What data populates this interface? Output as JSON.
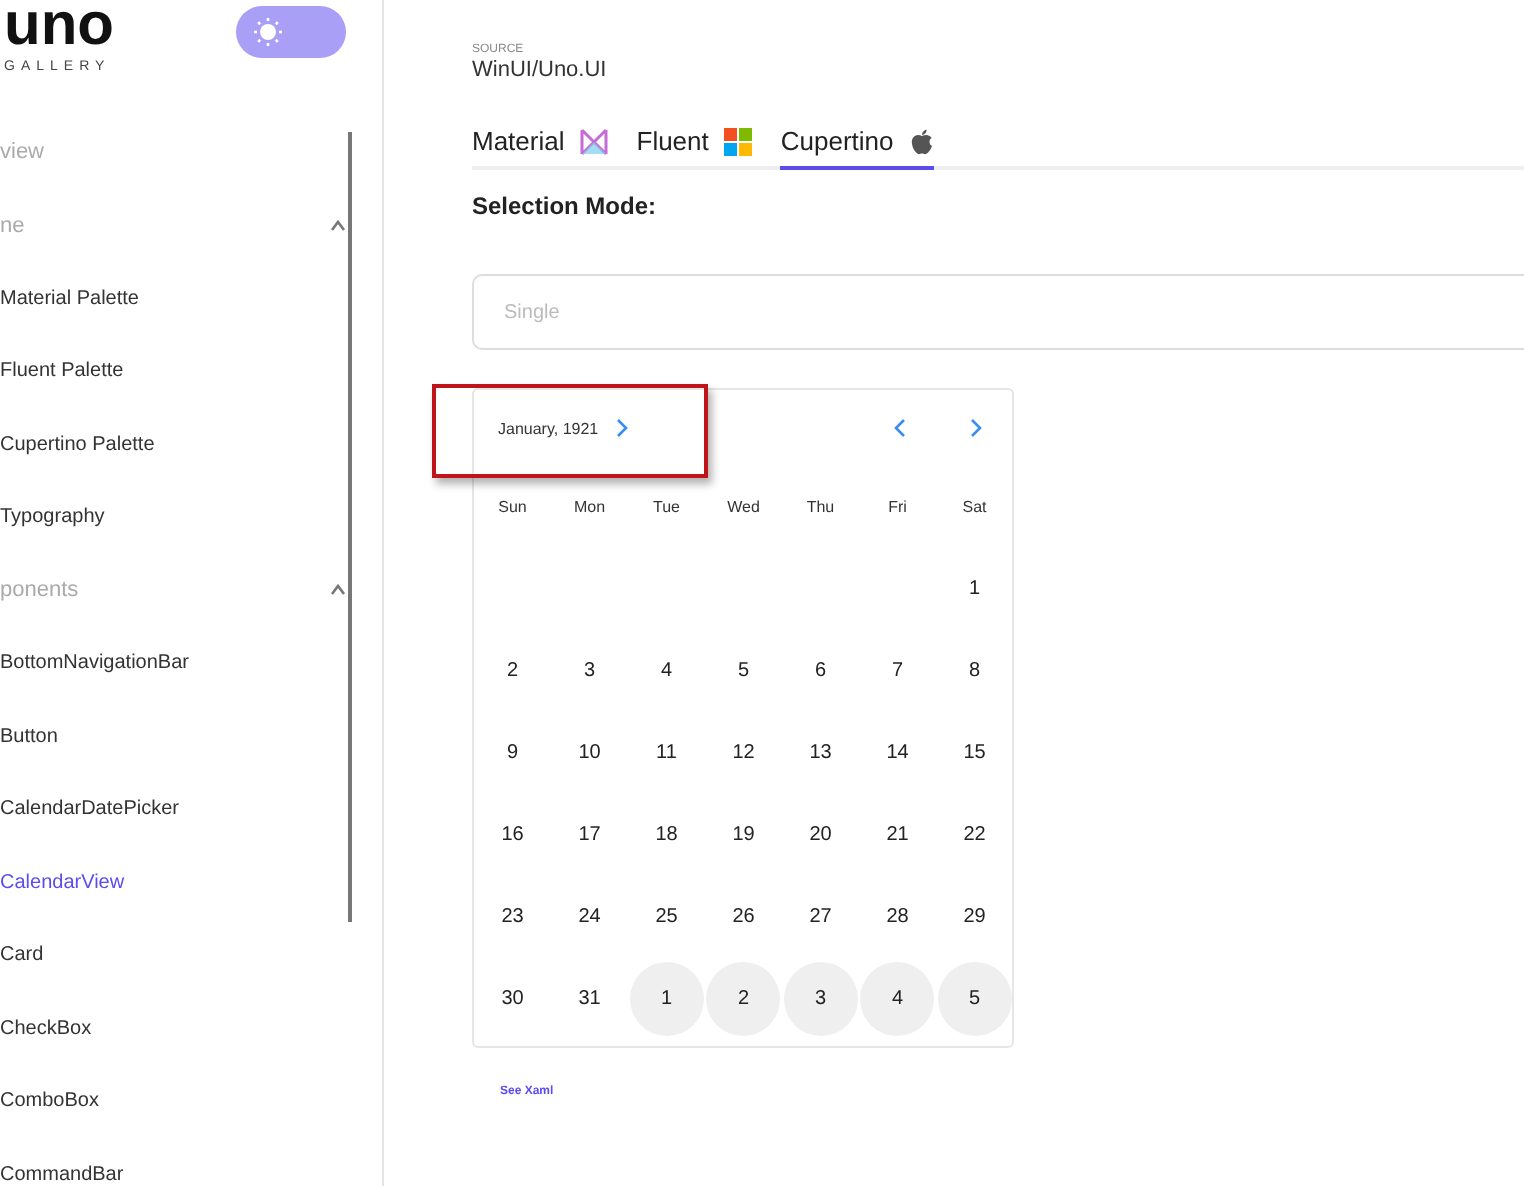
{
  "logo": {
    "wordmark": "uno",
    "subtitle": "GALLERY"
  },
  "theme_toggle": {
    "on": false
  },
  "sidebar": {
    "items": [
      {
        "label": "view",
        "kind": "link",
        "selected": false
      },
      {
        "label": "ne",
        "kind": "group",
        "expanded": true,
        "selected": false
      },
      {
        "label": "Material Palette",
        "kind": "item",
        "selected": false
      },
      {
        "label": "Fluent Palette",
        "kind": "item",
        "selected": false
      },
      {
        "label": "Cupertino Palette",
        "kind": "item",
        "selected": false
      },
      {
        "label": "Typography",
        "kind": "item",
        "selected": false
      },
      {
        "label": "ponents",
        "kind": "group",
        "expanded": true,
        "selected": false
      },
      {
        "label": "BottomNavigationBar",
        "kind": "item",
        "selected": false
      },
      {
        "label": "Button",
        "kind": "item",
        "selected": false
      },
      {
        "label": "CalendarDatePicker",
        "kind": "item",
        "selected": false
      },
      {
        "label": "CalendarView",
        "kind": "item",
        "selected": true
      },
      {
        "label": "Card",
        "kind": "item",
        "selected": false
      },
      {
        "label": "CheckBox",
        "kind": "item",
        "selected": false
      },
      {
        "label": "ComboBox",
        "kind": "item",
        "selected": false
      },
      {
        "label": "CommandBar",
        "kind": "item",
        "selected": false
      }
    ]
  },
  "source": {
    "caption": "SOURCE",
    "value": "WinUI/Uno.UI"
  },
  "tabs": [
    {
      "label": "Material",
      "kind": "material",
      "selected": false
    },
    {
      "label": "Fluent",
      "kind": "fluent",
      "selected": false
    },
    {
      "label": "Cupertino",
      "kind": "cupertino",
      "selected": true
    }
  ],
  "selection_mode": {
    "label": "Selection Mode:",
    "placeholder": "Single"
  },
  "calendar": {
    "month": "January, 1921",
    "weekdays": [
      "Sun",
      "Mon",
      "Tue",
      "Wed",
      "Thu",
      "Fri",
      "Sat"
    ],
    "days": [
      {
        "label": "1",
        "kind": "current"
      },
      {
        "label": "2",
        "kind": "current"
      },
      {
        "label": "3",
        "kind": "current"
      },
      {
        "label": "4",
        "kind": "current"
      },
      {
        "label": "5",
        "kind": "current"
      },
      {
        "label": "6",
        "kind": "current"
      },
      {
        "label": "7",
        "kind": "current"
      },
      {
        "label": "8",
        "kind": "current"
      },
      {
        "label": "9",
        "kind": "current"
      },
      {
        "label": "10",
        "kind": "current"
      },
      {
        "label": "11",
        "kind": "current"
      },
      {
        "label": "12",
        "kind": "current"
      },
      {
        "label": "13",
        "kind": "current"
      },
      {
        "label": "14",
        "kind": "current"
      },
      {
        "label": "15",
        "kind": "current"
      },
      {
        "label": "16",
        "kind": "current"
      },
      {
        "label": "17",
        "kind": "current"
      },
      {
        "label": "18",
        "kind": "current"
      },
      {
        "label": "19",
        "kind": "current"
      },
      {
        "label": "20",
        "kind": "current"
      },
      {
        "label": "21",
        "kind": "current"
      },
      {
        "label": "22",
        "kind": "current"
      },
      {
        "label": "23",
        "kind": "current"
      },
      {
        "label": "24",
        "kind": "current"
      },
      {
        "label": "25",
        "kind": "current"
      },
      {
        "label": "26",
        "kind": "current"
      },
      {
        "label": "27",
        "kind": "current"
      },
      {
        "label": "28",
        "kind": "current"
      },
      {
        "label": "29",
        "kind": "current"
      },
      {
        "label": "30",
        "kind": "current"
      },
      {
        "label": "31",
        "kind": "current"
      },
      {
        "label": "1",
        "kind": "next"
      },
      {
        "label": "2",
        "kind": "next"
      },
      {
        "label": "3",
        "kind": "next"
      },
      {
        "label": "4",
        "kind": "next"
      },
      {
        "label": "5",
        "kind": "next"
      }
    ]
  },
  "see_xaml": "See Xaml",
  "annotation": {
    "highlight": true
  }
}
